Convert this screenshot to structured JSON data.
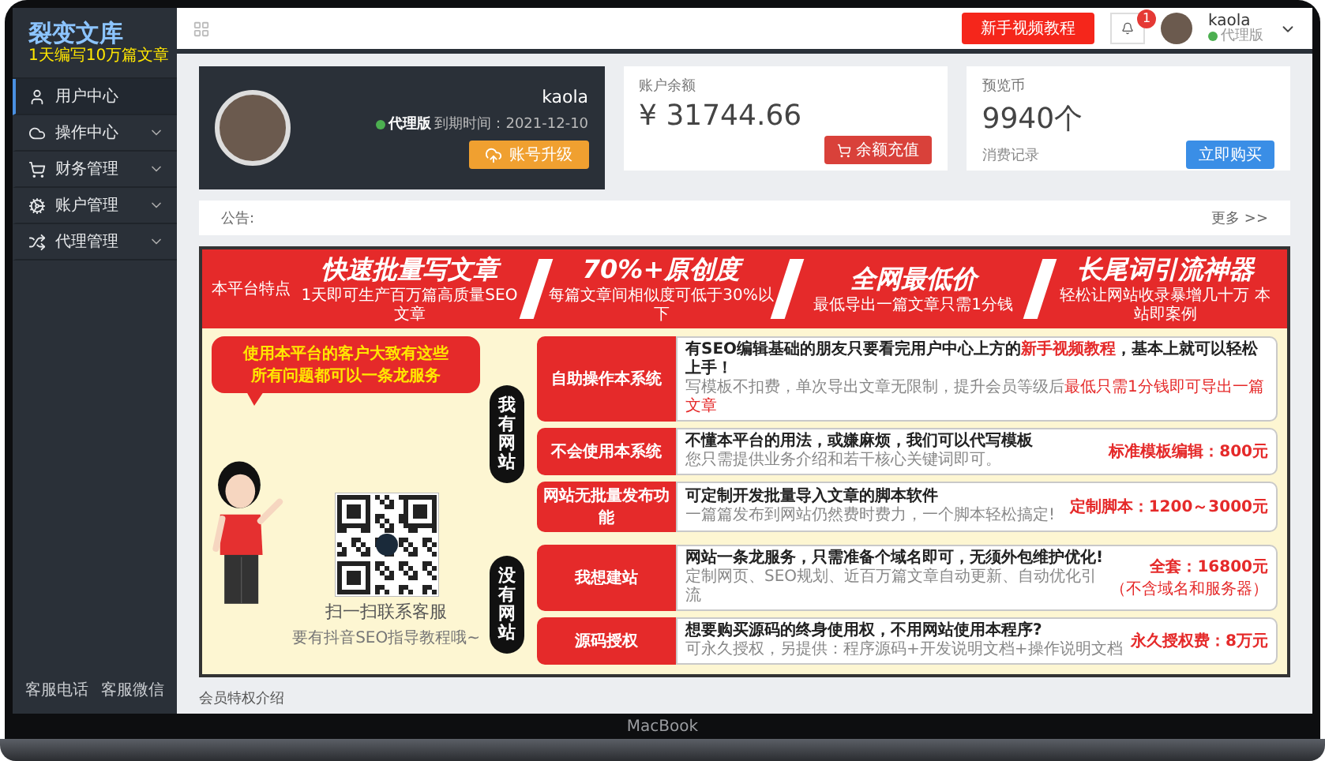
{
  "brand": {
    "name": "裂变文库",
    "slogan": "1天编写10万篇文章"
  },
  "sidebar": {
    "items": [
      {
        "label": "用户中心",
        "selected": true,
        "expandable": false
      },
      {
        "label": "操作中心",
        "selected": false,
        "expandable": true
      },
      {
        "label": "财务管理",
        "selected": false,
        "expandable": true
      },
      {
        "label": "账户管理",
        "selected": false,
        "expandable": true
      },
      {
        "label": "代理管理",
        "selected": false,
        "expandable": true
      }
    ],
    "footer_links": [
      "客服电话",
      "客服微信"
    ]
  },
  "header": {
    "tutorial_button": "新手视频教程",
    "notification_count": "1",
    "user": {
      "name": "kaola",
      "role": "代理版"
    }
  },
  "profile_card": {
    "name": "kaola",
    "role": "代理版",
    "expiry": "到期时间：2021-12-10",
    "button": "账号升级"
  },
  "balance_card": {
    "label": "账户余额",
    "amount": "¥ 31744.66",
    "button": "余额充值"
  },
  "coin_card": {
    "label": "预览币",
    "amount": "9940个",
    "link": "消费记录",
    "button": "立即购买"
  },
  "notice": {
    "label": "公告:",
    "more": "更多 >>"
  },
  "banner": {
    "intro": "本平台特点",
    "features": [
      {
        "title": "快速批量写文章",
        "subtitle": "1天即可生产百万篇高质量SEO文章"
      },
      {
        "title": "70%+原创度",
        "subtitle": "每篇文章间相似度可低于30%以下"
      },
      {
        "title": "全网最低价",
        "subtitle": "最低导出一篇文章只需1分钱"
      },
      {
        "title": "长尾词引流神器",
        "subtitle": "轻松让网站收录暴增几十万 本站即案例"
      }
    ],
    "speech": [
      "使用本平台的客户大致有这些",
      "所有问题都可以一条龙服务"
    ],
    "qr_caption": "扫一扫联系客服",
    "qr_note": "要有抖音SEO指导教程哦~",
    "groups": [
      {
        "label": "我有网站",
        "rows": [
          {
            "tag": "自助操作本系统",
            "title": "有SEO编辑基础的朋友只要看完用户中心上方的**新手视频教程**，基本上就可以轻松上手！",
            "detail": "写模板不扣费，单次导出文章无限制，提升会员等级后**最低只需1分钱即可导出一篇文章**"
          },
          {
            "tag": "不会使用本系统",
            "title": "不懂本平台的用法，或嫌麻烦，我们可以代写模板",
            "detail": "您只需提供业务介绍和若干核心关键词即可。",
            "price": "标准模板编辑：800元"
          },
          {
            "tag": "网站无批量发布功能",
            "title": "可定制开发批量导入文章的脚本软件",
            "detail": "一篇篇发布到网站仍然费时费力，一个脚本轻松搞定!",
            "price": "定制脚本：1200～3000元"
          }
        ]
      },
      {
        "label": "没有网站",
        "rows": [
          {
            "tag": "我想建站",
            "title": "网站一条龙服务，只需准备个域名即可，无须外包维护优化!",
            "detail": "定制网页、SEO规划、近百万篇文章自动更新、自动优化引流",
            "price": "全套：16800元",
            "price_note": "（不含域名和服务器）"
          },
          {
            "tag": "源码授权",
            "title": "想要购买源码的终身使用权，不用网站使用本程序?",
            "detail": "可永久授权，另提供：程序源码+开发说明文档+操作说明文档",
            "price": "永久授权费：8万元"
          }
        ]
      }
    ]
  },
  "footer": {
    "title": "会员特权介绍"
  },
  "laptop": {
    "label": "MacBook"
  }
}
